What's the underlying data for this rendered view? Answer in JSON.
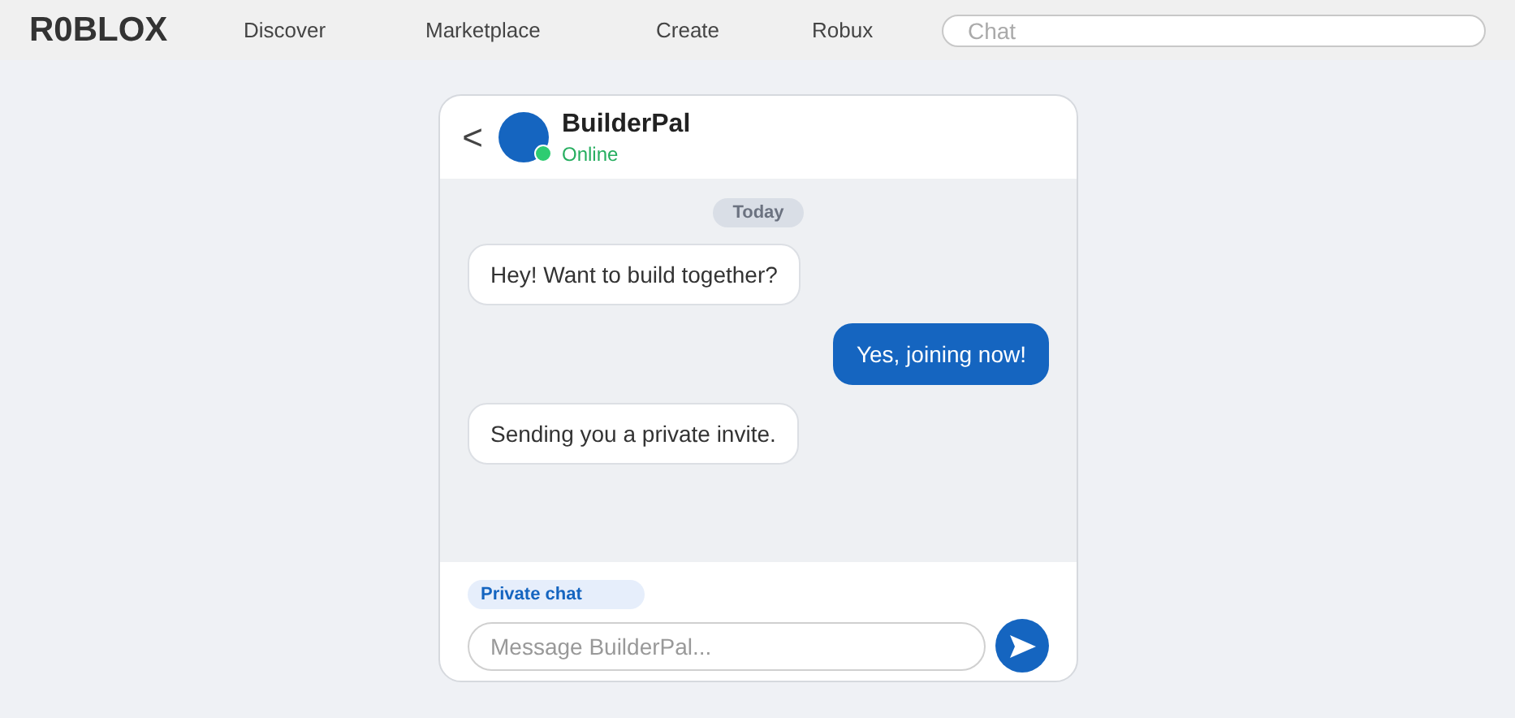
{
  "topbar": {
    "logo": "R0BLOX",
    "nav": [
      "Discover",
      "Marketplace",
      "Create",
      "Robux"
    ],
    "search": {
      "placeholder": "Chat"
    }
  },
  "chat": {
    "back": "<",
    "contact": {
      "name": "BuilderPal",
      "status": "Online",
      "online": true
    },
    "date": "Today",
    "messages": [
      {
        "kind": "received",
        "text": "Hey! Want to build together?"
      },
      {
        "kind": "sent",
        "text": "Yes, joining now!"
      },
      {
        "kind": "received",
        "text": "Sending you a private invite."
      }
    ],
    "tag": "Private chat",
    "composer": {
      "placeholder": "Message BuilderPal..."
    }
  }
}
